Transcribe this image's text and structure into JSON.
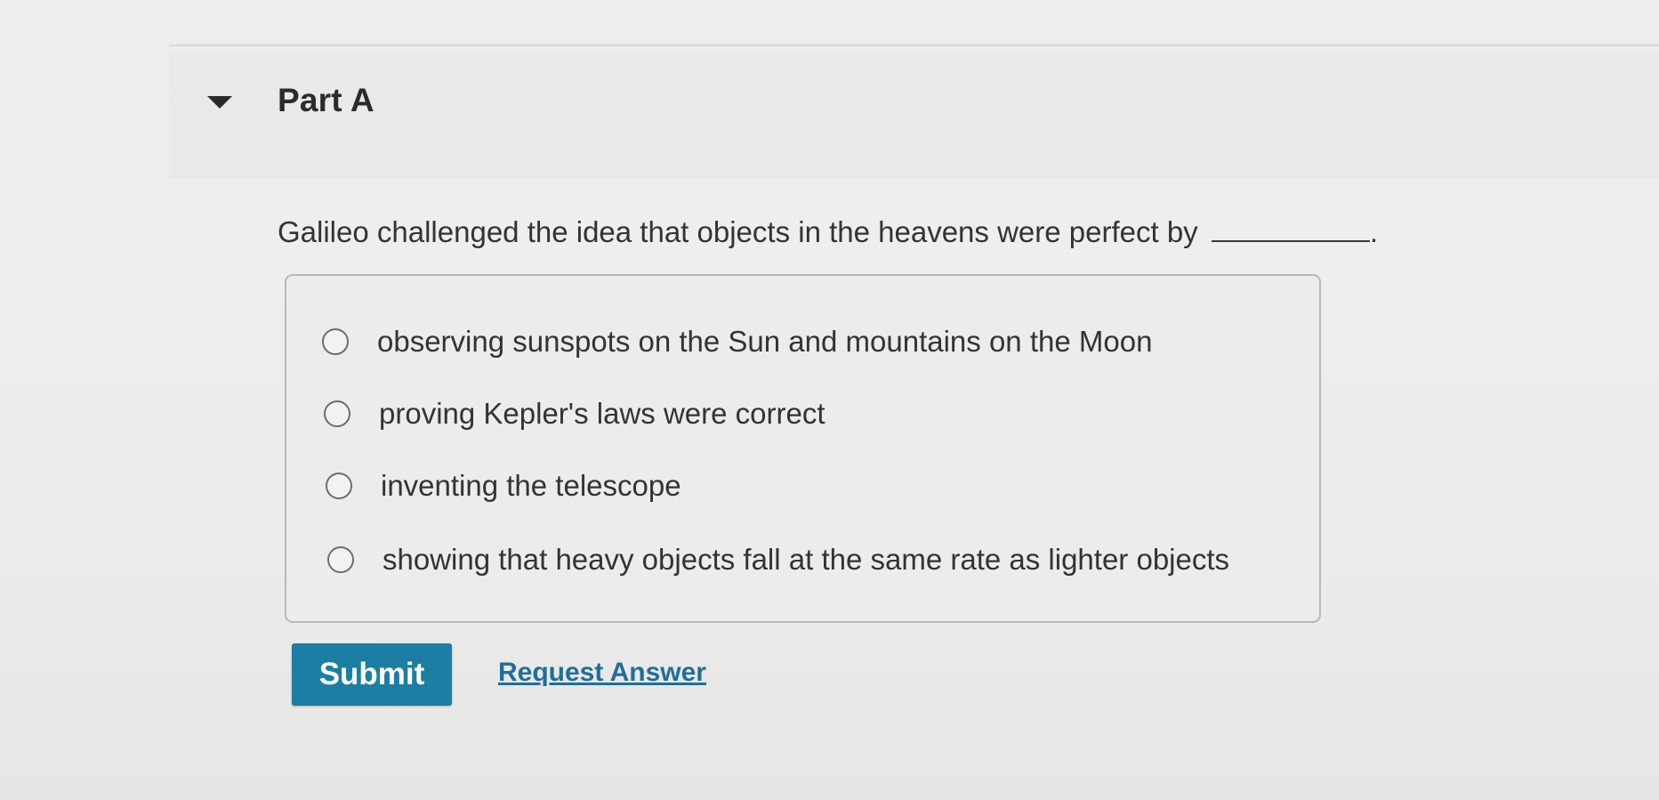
{
  "part": {
    "title": "Part A",
    "toggle_icon": "caret-down-icon"
  },
  "question": {
    "text": "Galileo challenged the idea that objects in the heavens were perfect by",
    "terminator": "."
  },
  "options": [
    {
      "label": "observing sunspots on the Sun and mountains on the Moon",
      "selected": false
    },
    {
      "label": "proving Kepler's laws were correct",
      "selected": false
    },
    {
      "label": "inventing the telescope",
      "selected": false
    },
    {
      "label": "showing that heavy objects fall at the same rate as lighter objects",
      "selected": false
    }
  ],
  "actions": {
    "submit_label": "Submit",
    "request_answer_label": "Request Answer"
  },
  "colors": {
    "submit_background": "#1c7ea3",
    "link": "#1f6f9a"
  }
}
